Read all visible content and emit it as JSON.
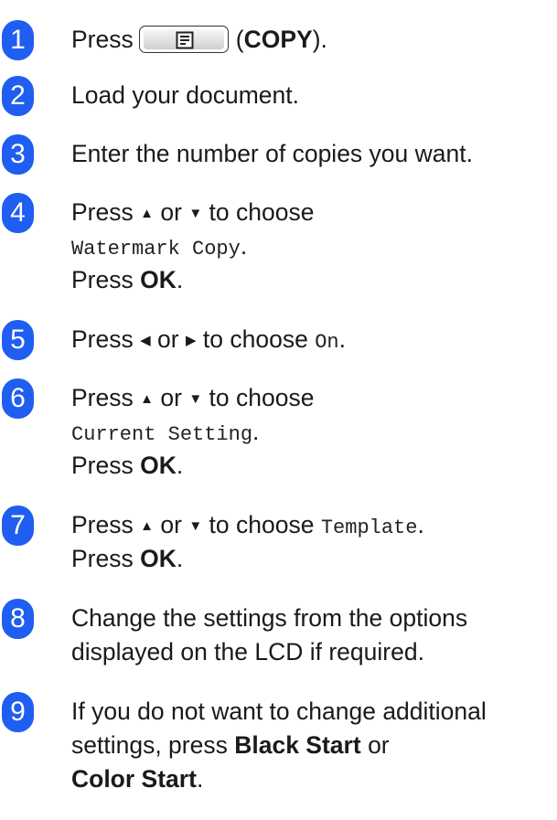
{
  "steps": [
    {
      "num": "1",
      "press": "Press",
      "label": "(",
      "bold": "COPY",
      "tail": ")."
    },
    {
      "num": "2",
      "text": "Load your document."
    },
    {
      "num": "3",
      "text": "Enter the number of copies you want."
    },
    {
      "num": "4",
      "press": "Press",
      "up": "▲",
      "or": "or",
      "down": "▼",
      "to_choose": "to choose",
      "option": "Watermark Copy",
      "period": ".",
      "press2": "Press",
      "ok": "OK",
      "period2": "."
    },
    {
      "num": "5",
      "press": "Press",
      "left": "◀",
      "or": "or",
      "right": "▶",
      "to_choose": "to choose",
      "option": "On",
      "period": "."
    },
    {
      "num": "6",
      "press": "Press",
      "up": "▲",
      "or": "or",
      "down": "▼",
      "to_choose": "to choose",
      "option": "Current Setting",
      "period": ".",
      "press2": "Press",
      "ok": "OK",
      "period2": "."
    },
    {
      "num": "7",
      "press": "Press",
      "up": "▲",
      "or": "or",
      "down": "▼",
      "to_choose": "to choose",
      "option": "Template",
      "period": ".",
      "press2": "Press",
      "ok": "OK",
      "period2": "."
    },
    {
      "num": "8",
      "line1": "Change the settings from the options",
      "line2": "displayed on the LCD if required."
    },
    {
      "num": "9",
      "line1": "If you do not want to change additional",
      "line2a": "settings, press",
      "black": "Black Start",
      "or": "or",
      "color": "Color Start",
      "period": "."
    }
  ],
  "colors": {
    "badge": "#1f5ef0",
    "text": "#1a1a1a"
  },
  "icons": {
    "copy_button": "copy-document-icon"
  }
}
